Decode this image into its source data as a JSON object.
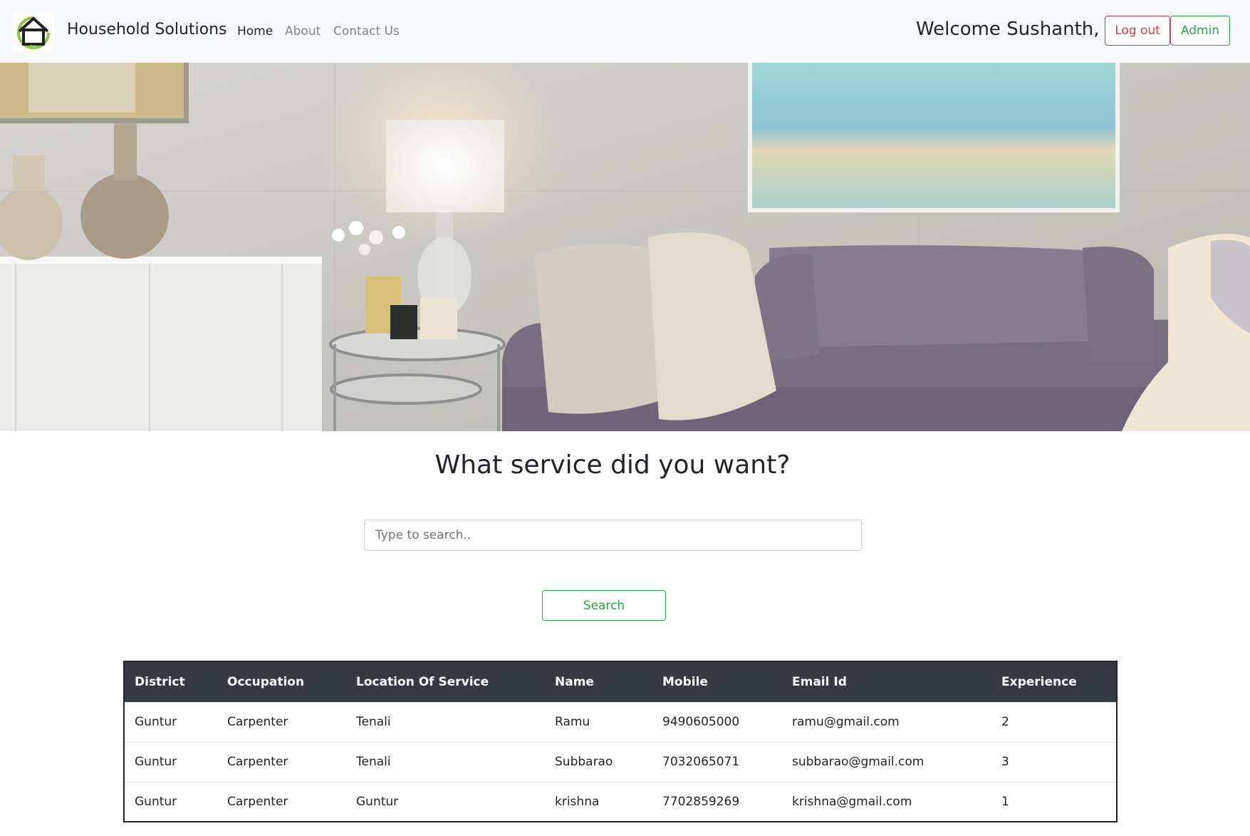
{
  "navbar": {
    "brand": "Household Solutions",
    "links": [
      {
        "label": "Home",
        "active": true
      },
      {
        "label": "About",
        "active": false
      },
      {
        "label": "Contact Us",
        "active": false
      }
    ],
    "welcome": "Welcome Sushanth,",
    "logout_label": "Log out",
    "admin_label": "Admin"
  },
  "main": {
    "heading": "What service did you want?",
    "search_placeholder": "Type to search..",
    "search_value": "",
    "search_button": "Search"
  },
  "table": {
    "columns": [
      "District",
      "Occupation",
      "Location Of Service",
      "Name",
      "Mobile",
      "Email Id",
      "Experience"
    ],
    "rows": [
      [
        "Guntur",
        "Carpenter",
        "Tenali",
        "Ramu",
        "9490605000",
        "ramu@gmail.com",
        "2"
      ],
      [
        "Guntur",
        "Carpenter",
        "Tenali",
        "Subbarao",
        "7032065071",
        "subbarao@gmail.com",
        "3"
      ],
      [
        "Guntur",
        "Carpenter",
        "Guntur",
        "krishna",
        "7702859269",
        "krishna@gmail.com",
        "1"
      ]
    ]
  },
  "colors": {
    "navbar_bg": "#f8f9fa",
    "logout": "#dc3545",
    "admin": "#28a745",
    "table_header_bg": "#343a40"
  },
  "icons": {
    "logo": "house-logo-icon"
  }
}
